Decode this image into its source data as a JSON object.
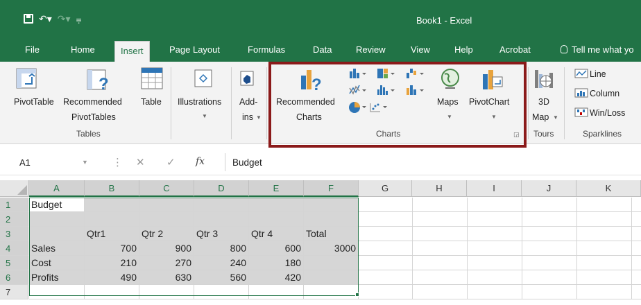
{
  "window": {
    "title": "Book1  -  Excel"
  },
  "tabs": [
    "File",
    "Home",
    "Insert",
    "Page Layout",
    "Formulas",
    "Data",
    "Review",
    "View",
    "Help",
    "Acrobat"
  ],
  "tell_me": "Tell me what yo",
  "ribbon": {
    "pivottable": "PivotTable",
    "recommended_pivottables": [
      "Recommended",
      "PivotTables"
    ],
    "table": "Table",
    "tables_group": "Tables",
    "illustrations": "Illustrations",
    "addins": [
      "Add-",
      "ins"
    ],
    "recommended_charts": [
      "Recommended",
      "Charts"
    ],
    "maps": "Maps",
    "pivotchart": "PivotChart",
    "charts_group": "Charts",
    "map3d": [
      "3D",
      "Map"
    ],
    "tours_group": "Tours",
    "sparklines": [
      "Line",
      "Column",
      "Win/Loss"
    ],
    "sparklines_group": "Sparklines"
  },
  "formula_bar": {
    "name_box": "A1",
    "value": "Budget"
  },
  "columns": [
    "A",
    "B",
    "C",
    "D",
    "E",
    "F",
    "G",
    "H",
    "I",
    "J",
    "K"
  ],
  "rows": [
    [
      "Budget",
      "",
      "",
      "",
      "",
      ""
    ],
    [
      "",
      "",
      "",
      "",
      "",
      ""
    ],
    [
      "",
      "Qtr1",
      "Qtr 2",
      "Qtr 3",
      "Qtr 4",
      "Total"
    ],
    [
      "Sales",
      "700",
      "900",
      "800",
      "600",
      "3000"
    ],
    [
      "Cost",
      "210",
      "270",
      "240",
      "180",
      ""
    ],
    [
      "Profits",
      "490",
      "630",
      "560",
      "420",
      ""
    ],
    [
      "",
      "",
      "",
      "",
      "",
      ""
    ]
  ],
  "row_numbers": [
    "1",
    "2",
    "3",
    "4",
    "5",
    "6",
    "7"
  ],
  "colors": {
    "excel_green": "#217346",
    "highlight": "#8b1a1a",
    "selection_fill": "#d6d6d6"
  }
}
